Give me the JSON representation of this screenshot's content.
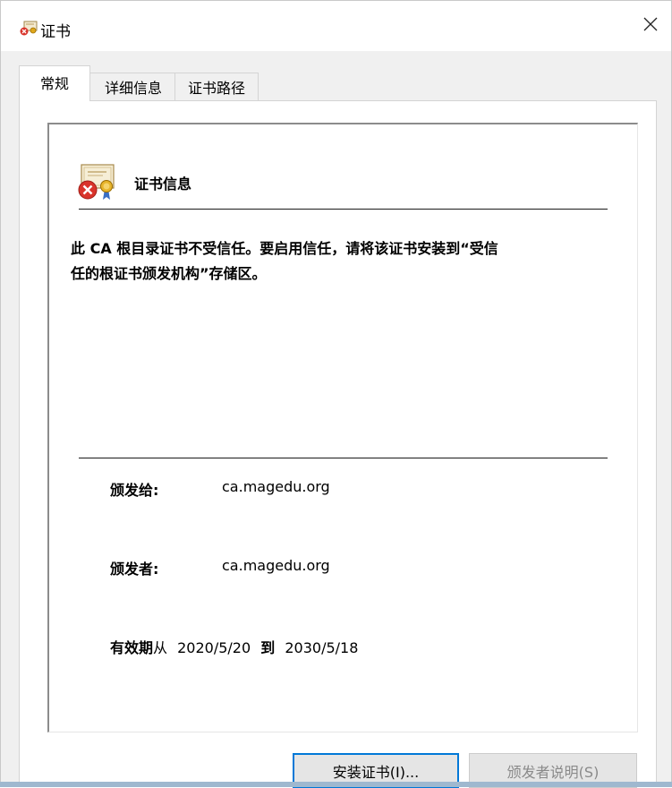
{
  "window": {
    "title": "证书",
    "title_icon": "certificate-error-icon",
    "close_icon": "close-icon"
  },
  "tabs": [
    {
      "label": "常规",
      "active": true
    },
    {
      "label": "详细信息",
      "active": false
    },
    {
      "label": "证书路径",
      "active": false
    }
  ],
  "general": {
    "heading": "证书信息",
    "heading_icon": "certificate-error-icon",
    "warning_line1": "此 CA 根目录证书不受信任。要启用信任，请将该证书安装到“受信",
    "warning_line2": "任的根证书颁发机构”存储区。",
    "issued_to_label": "颁发给:",
    "issued_to_value": "ca.magedu.org",
    "issued_by_label": "颁发者:",
    "issued_by_value": "ca.magedu.org",
    "validity_label": "有效期",
    "validity_from_word": "从",
    "validity_from": "2020/5/20",
    "validity_to_word": "到",
    "validity_to": "2030/5/18"
  },
  "buttons": {
    "install": "安装证书(I)...",
    "issuer_statement": "颁发者说明(S)"
  },
  "colors": {
    "accent": "#0078d7",
    "disabled_text": "#8a8a8a",
    "error_red": "#d9342b",
    "seal_gold": "#e0a81c"
  }
}
